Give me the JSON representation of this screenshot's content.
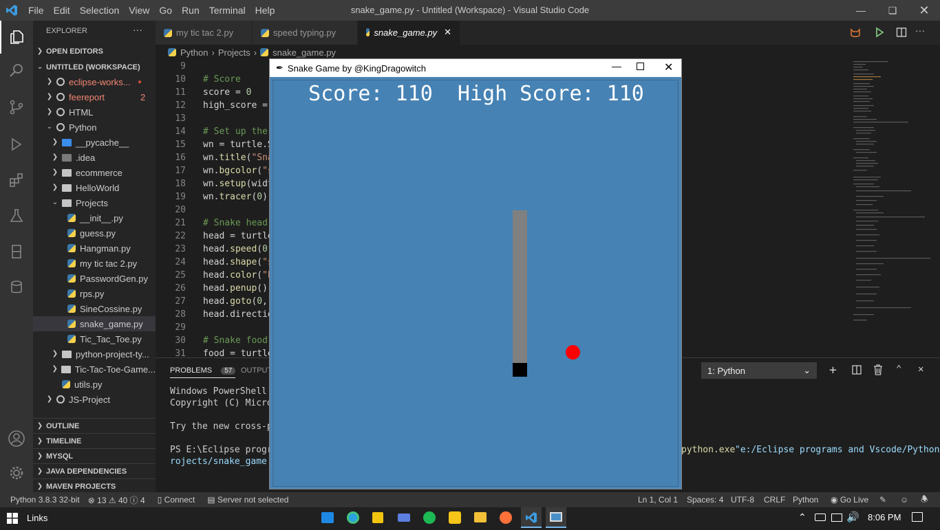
{
  "titlebar": {
    "menu": [
      "File",
      "Edit",
      "Selection",
      "View",
      "Go",
      "Run",
      "Terminal",
      "Help"
    ],
    "title": "snake_game.py - Untitled (Workspace) - Visual Studio Code"
  },
  "sidebar": {
    "header": "EXPLORER",
    "open_editors": "OPEN EDITORS",
    "workspace": "UNTITLED (WORKSPACE)",
    "items": [
      {
        "label": "eclipse-works...",
        "badge": "●"
      },
      {
        "label": "feereport",
        "badge": "2"
      },
      {
        "label": "HTML",
        "badge": ""
      },
      {
        "label": "Python",
        "badge": ""
      },
      {
        "label": "__pycache__",
        "badge": ""
      },
      {
        "label": ".idea",
        "badge": ""
      },
      {
        "label": "ecommerce",
        "badge": ""
      },
      {
        "label": "HelloWorld",
        "badge": ""
      },
      {
        "label": "Projects",
        "badge": ""
      },
      {
        "label": "__init__.py",
        "badge": ""
      },
      {
        "label": "guess.py",
        "badge": ""
      },
      {
        "label": "Hangman.py",
        "badge": ""
      },
      {
        "label": "my tic tac 2.py",
        "badge": ""
      },
      {
        "label": "PasswordGen.py",
        "badge": ""
      },
      {
        "label": "rps.py",
        "badge": ""
      },
      {
        "label": "SineCossine.py",
        "badge": ""
      },
      {
        "label": "snake_game.py",
        "badge": ""
      },
      {
        "label": "Tic_Tac_Toe.py",
        "badge": ""
      },
      {
        "label": "python-project-ty...",
        "badge": ""
      },
      {
        "label": "Tic-Tac-Toe-Game...",
        "badge": ""
      },
      {
        "label": "utils.py",
        "badge": ""
      },
      {
        "label": "JS-Project",
        "badge": ""
      }
    ],
    "sections": [
      "OUTLINE",
      "TIMELINE",
      "MYSQL",
      "JAVA DEPENDENCIES",
      "MAVEN PROJECTS"
    ]
  },
  "tabs": [
    {
      "label": "my tic tac 2.py"
    },
    {
      "label": "speed typing.py"
    },
    {
      "label": "snake_game.py"
    }
  ],
  "breadcrumb": [
    "Python",
    "Projects",
    "snake_game.py"
  ],
  "editor": {
    "lines": [
      {
        "n": "9",
        "t": ""
      },
      {
        "n": "10",
        "t": "# Score"
      },
      {
        "n": "11",
        "t": "score = 0"
      },
      {
        "n": "12",
        "t": "high_score ="
      },
      {
        "n": "13",
        "t": ""
      },
      {
        "n": "14",
        "t": "# Set up the"
      },
      {
        "n": "15",
        "t": "wn = turtle.S"
      },
      {
        "n": "16",
        "t": "wn.title(\"Sna"
      },
      {
        "n": "17",
        "t": "wn.bgcolor(\"s"
      },
      {
        "n": "18",
        "t": "wn.setup(widt"
      },
      {
        "n": "19",
        "t": "wn.tracer(0)"
      },
      {
        "n": "20",
        "t": ""
      },
      {
        "n": "21",
        "t": "# Snake head"
      },
      {
        "n": "22",
        "t": "head = turtle"
      },
      {
        "n": "23",
        "t": "head.speed(0)"
      },
      {
        "n": "24",
        "t": "head.shape(\"s"
      },
      {
        "n": "25",
        "t": "head.color(\"b"
      },
      {
        "n": "26",
        "t": "head.penup()"
      },
      {
        "n": "27",
        "t": "head.goto(0,"
      },
      {
        "n": "28",
        "t": "head.directio"
      },
      {
        "n": "29",
        "t": ""
      },
      {
        "n": "30",
        "t": "# Snake food"
      },
      {
        "n": "31",
        "t": "food = turtle"
      }
    ]
  },
  "panel": {
    "problems": "PROBLEMS",
    "problems_count": "57",
    "output": "OUTPUT",
    "terminal_select": "1: Python",
    "terminal": [
      "Windows PowerShell",
      "Copyright (C) Microso",
      "",
      "Try the new cross-pla",
      "",
      "PS E:\\Eclipse program",
      "rojects/snake_game.py"
    ],
    "terminal_right_a": "python.exe",
    "terminal_right_b": "\"e:/Eclipse programs and Vscode/Python/P"
  },
  "status": {
    "python": "Python 3.8.3 32-bit",
    "errors": "13",
    "warnings": "40",
    "info": "4",
    "connect": "Connect",
    "server": "Server not selected",
    "position": "Ln 1, Col 1",
    "spaces": "Spaces: 4",
    "encoding": "UTF-8",
    "eol": "CRLF",
    "language": "Python",
    "golive": "Go Live"
  },
  "snake_window": {
    "title": "Snake Game by @KingDragowitch",
    "score_text": "Score: 110  High Score: 110"
  },
  "taskbar": {
    "links": "Links",
    "time": "8:06 PM"
  },
  "colors": {
    "accent": "#007acc",
    "game_bg": "#4682b4",
    "snake_body": "#808080",
    "snake_head": "#000000",
    "food": "#ff0000"
  }
}
